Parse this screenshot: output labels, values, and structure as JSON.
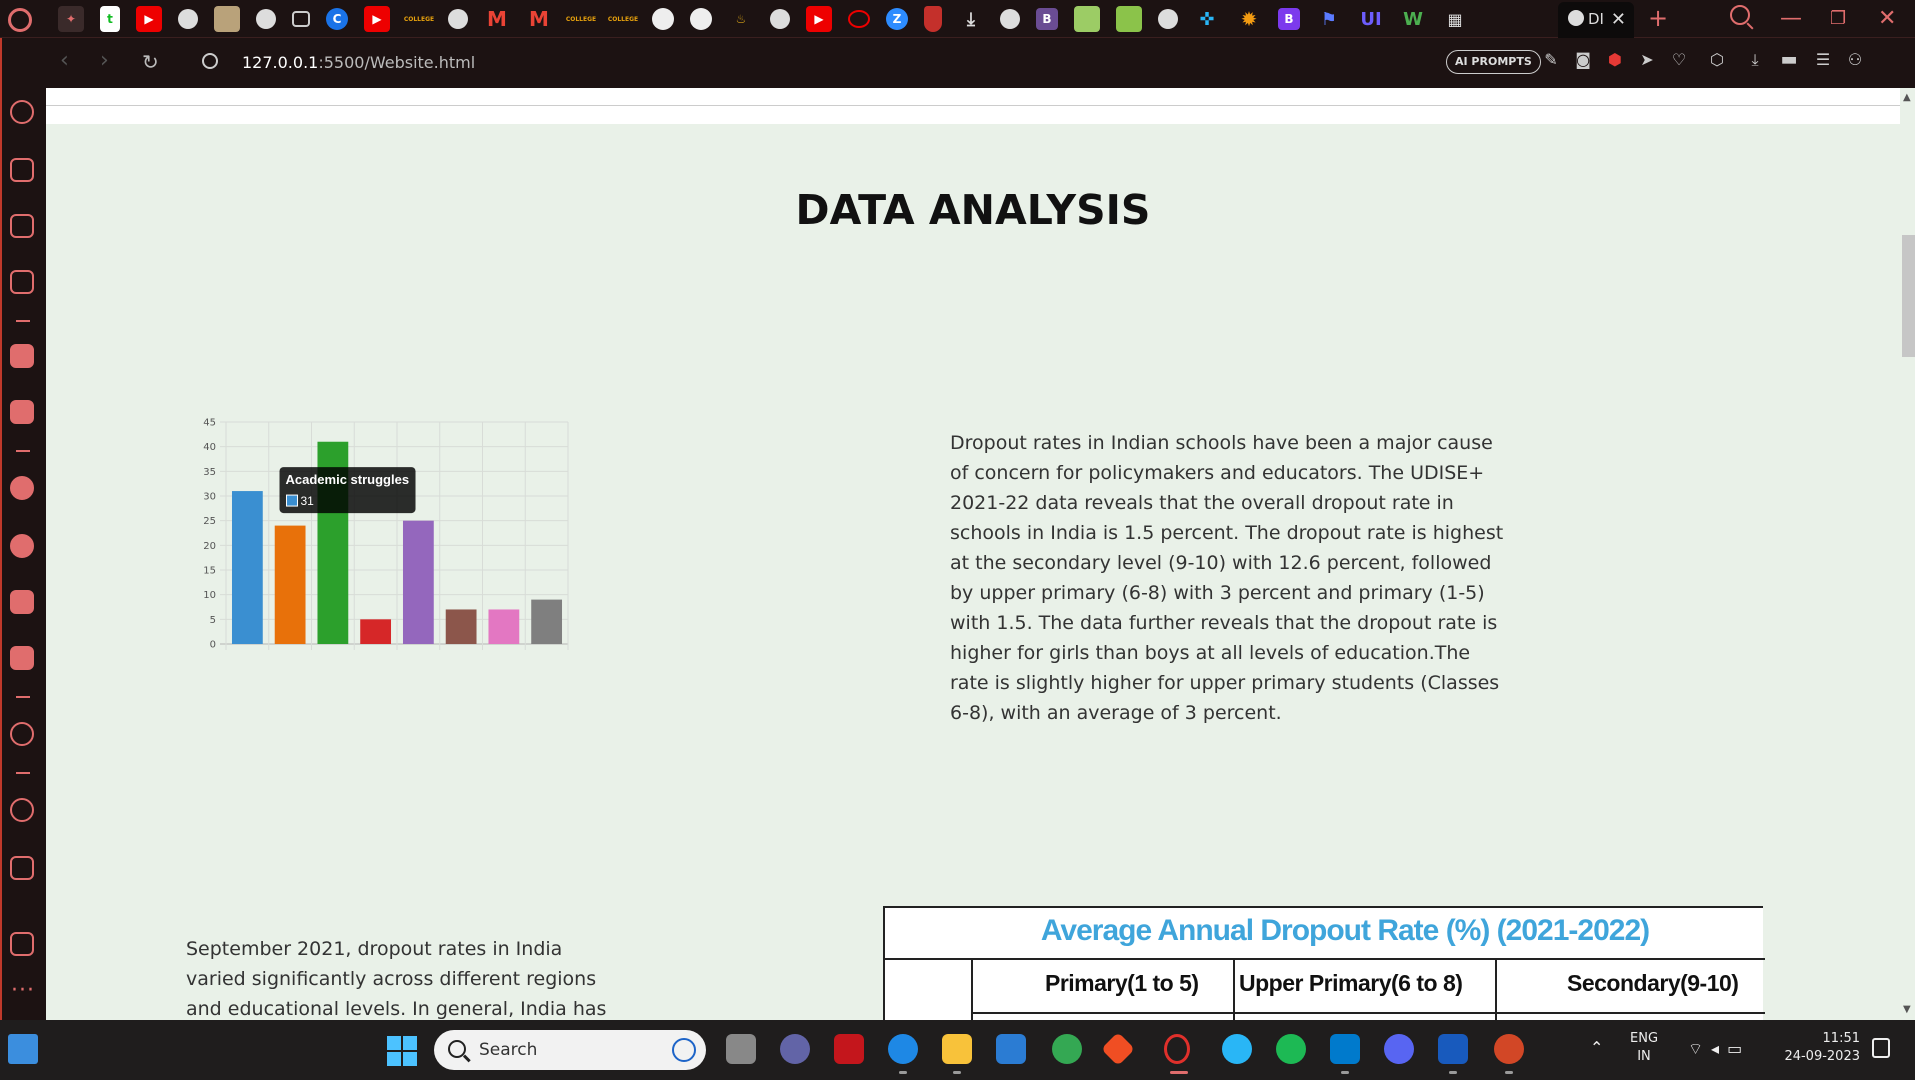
{
  "browser": {
    "tab_title": "DI",
    "url_host": "127.0.0.1",
    "url_rest": ":5500/Website.html",
    "ai_prompts_label": "AI PROMPTS"
  },
  "page": {
    "title": "DATA ANALYSIS",
    "paragraph_right": "Dropout rates in Indian schools have been a major cause of concern for policymakers and educators. The UDISE+ 2021-22 data reveals that the overall dropout rate in schools in India is 1.5 percent. The dropout rate is highest at the secondary level (9-10) with 12.6 percent, followed by upper primary (6-8) with 3 percent and primary (1-5) with 1.5. The data further reveals that the dropout rate is higher for girls than boys at all levels of education.The rate is slightly higher for upper primary students (Classes 6-8), with an average of 3 percent.",
    "paragraph_left": "September 2021, dropout rates in India varied significantly across different regions and educational levels. In general, India has",
    "table": {
      "title": "Average Annual Dropout Rate (%) (2021-2022)",
      "col1": "Primary(1 to 5)",
      "col2": "Upper Primary(6 to 8)",
      "col3": "Secondary(9-10)"
    }
  },
  "chart_data": {
    "type": "bar",
    "categories": [
      "Academic struggles",
      "",
      "",
      "",
      "",
      "",
      "",
      ""
    ],
    "values": [
      31,
      24,
      41,
      5,
      25,
      7,
      7,
      9
    ],
    "colors": [
      "#3a8fd1",
      "#e8710a",
      "#2ca02c",
      "#d62728",
      "#9467bd",
      "#8c564b",
      "#e377c2",
      "#7f7f7f"
    ],
    "ylim": [
      0,
      45
    ],
    "yticks": [
      0,
      5,
      10,
      15,
      20,
      25,
      30,
      35,
      40,
      45
    ],
    "grid": true,
    "tooltip": {
      "label": "Academic struggles",
      "value": "31"
    }
  },
  "taskbar": {
    "search_placeholder": "Search",
    "lang_top": "ENG",
    "lang_bottom": "IN",
    "time": "11:51",
    "date": "24-09-2023"
  }
}
